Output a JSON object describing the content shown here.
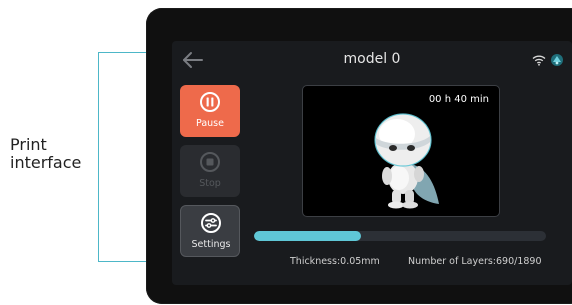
{
  "annotation": {
    "label": "Print\ninterface",
    "line1": "Print",
    "line2": "interface",
    "accent_color": "#4db7c8"
  },
  "header": {
    "title": "model 0",
    "back_icon": "arrow-left-icon",
    "status_icons": [
      "wifi-icon",
      "network-icon"
    ]
  },
  "buttons": {
    "pause": {
      "label": "Pause",
      "icon": "pause-circle-icon",
      "color": "#ee6a4b"
    },
    "stop": {
      "label": "Stop",
      "icon": "stop-circle-icon",
      "color": "#2a2c30"
    },
    "settings": {
      "label": "Settings",
      "icon": "settings-sliders-icon",
      "color": "#3a3d42"
    }
  },
  "preview": {
    "time_remaining": "00 h 40 min"
  },
  "progress": {
    "fraction": 0.365,
    "fill_color": "#5fc7d6"
  },
  "info": {
    "thickness": "Thickness:0.05mm",
    "layers": "Number of Layers:690/1890"
  }
}
